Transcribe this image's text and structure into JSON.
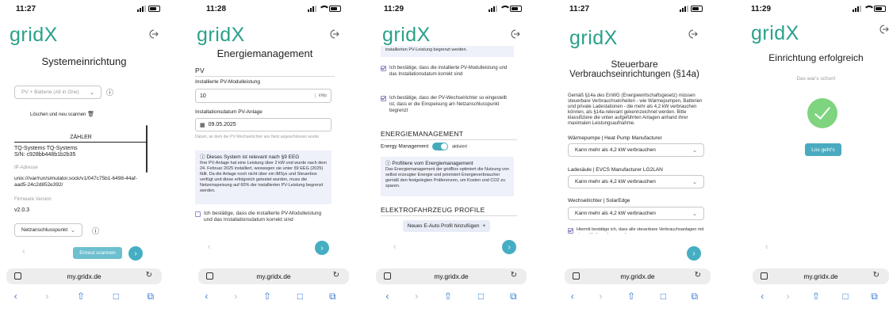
{
  "app": {
    "logo": "gridX",
    "url": "my.gridx.de"
  },
  "screens": [
    {
      "time": "11:27",
      "title": "Systemeinrichtung",
      "system_select": "PV + Batterie (All in One)",
      "delete_label": "Löschen und neu scannen",
      "zahler_header": "ZÄHLER",
      "meter_name": "TQ-Systems TQ-Systems",
      "meter_sn": "S/N: c928bb448b1b2b35",
      "ip_label": "IP-Adresse",
      "ip_value": "unix:///var/run/simulator.sock/v1/047c75b1-6498-44af-aad5-24c2d852e392/",
      "fw_label": "Firmware Version",
      "fw_value": "v2.0.3",
      "point_select": "Netzanschlusspunkt",
      "rescan_label": "Erneut scannen"
    },
    {
      "time": "11:28",
      "title": "Energiemanagement",
      "pv_header": "PV",
      "power_label": "Installierte PV-Modulleistung",
      "power_value": "10",
      "power_unit": "kWp",
      "date_label": "Installationsdatum PV-Anlage",
      "date_value": "09.05.2025",
      "date_hint": "Datum, an dem der PV-Wechselrichter ans Netz angeschlossen wurde",
      "info_title": "Dieses System ist relevant nach §9 EEG",
      "info_text": "Ihre PV-Anlage hat eine Leistung über 2 kW und wurde nach dem 24. Februar 2025 installiert, weswegen sie unter §9 EEG (2025) fällt. Da die Anlage noch nicht über ein iMSys und Steuerbox verfügt und diese erfolgreich getestet wurden, muss die Netzeinspeisung auf 60% der installierten PV-Leistung begrenzt werden.",
      "confirm_text": "Ich bestätige, dass die installierte PV-Modulleistung und das Installationsdatum korrekt sind"
    },
    {
      "time": "11:29",
      "top_text": "installierten PV-Leistung begrenzt werden.",
      "confirm1": "Ich bestätige, dass die installierte PV-Modulleistung und das Installationsdatum korrekt sind",
      "confirm2": "Ich bestätige, dass der PV-Wechselrichter so eingestellt ist, dass er die Einspeisung am Netzanschlusspunkt begrenzt",
      "em_header": "ENERGIEMANAGEMENT",
      "em_label": "Energy Management",
      "em_state": "aktiviert",
      "profit_title": "Profitiere vom Energiemanagement",
      "profit_text": "Das Energiemanagement der gridBox optimiert die Nutzung von selbst erzeugter Energie und priorisiert Energieverbraucher gemäß den festgelegten Präferenzen, um Kosten und CO2 zu sparen.",
      "ev_header": "ELEKTROFAHRZEUG PROFILE",
      "ev_button": "Neues E-Auto Profil hinzufügen"
    },
    {
      "time": "11:27",
      "title_line1": "Steuerbare",
      "title_line2": "Verbrauchseinrichtungen (§14a)",
      "intro": "Gemäß §14a des EnWG (Energiewirtschaftsgesetz) müssen steuerbare Verbrauchseinheiten - wie Wärmepumpen, Batterien und private Ladestationen - die mehr als 4,2 kW verbrauchen können, als §14a-relevant gekennzeichnet werden. Bitte klassifiziere die unten aufgeführten Anlagen anhand ihrer maximalen Leistungsaufnahme.",
      "dev1_label": "Wärmepumpe | Heat Pump Manufacturer",
      "dev2_label": "Ladesäule | EVCS Manufacturer LG2LAN",
      "dev3_label": "Wechselrichter | SolarEdge",
      "option": "Kann mehr als 4,2 kW verbrauchen",
      "confirm": "Hiermit bestätige ich, dass alle steuerbare Verbrauchsanlagen mit einem Verbrauch von mehr"
    },
    {
      "time": "11:29",
      "title": "Einrichtung erfolgreich",
      "subtitle": "Das war's schon!",
      "button": "Los geht's"
    }
  ]
}
